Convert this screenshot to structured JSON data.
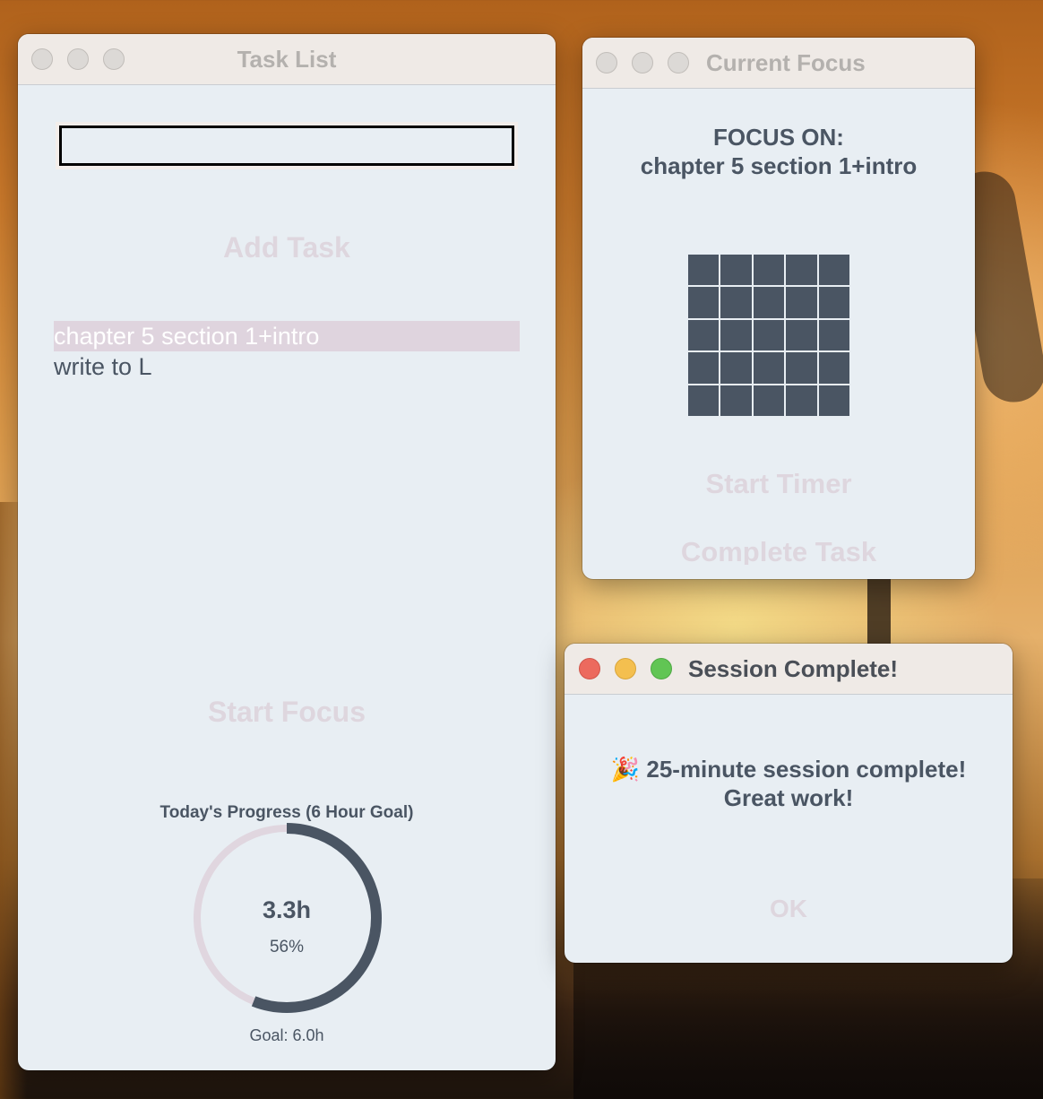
{
  "task_window": {
    "title": "Task List",
    "task_input": {
      "value": "",
      "placeholder": ""
    },
    "add_button": "Add Task",
    "tasks": [
      {
        "label": "chapter 5 section 1+intro",
        "selected": true
      },
      {
        "label": "write to L",
        "selected": false
      }
    ],
    "start_focus_button": "Start Focus",
    "progress": {
      "heading": "Today's Progress (6 Hour Goal)",
      "hours": "3.3h",
      "percent_label": "56%",
      "fraction": 0.56,
      "goal": "Goal: 6.0h"
    }
  },
  "focus_window": {
    "title": "Current Focus",
    "focus_label": "FOCUS ON:",
    "focus_task": "chapter 5 section 1+intro",
    "grid": {
      "rows": 5,
      "cols": 5
    },
    "start_timer_button": "Start Timer",
    "complete_task_button": "Complete Task"
  },
  "dialog": {
    "title": "Session Complete!",
    "emoji": "🎉",
    "message": "25-minute session complete!",
    "message2": "Great work!",
    "ok_button": "OK"
  },
  "colors": {
    "window_bg": "#e8eef3",
    "text": "#4a5563",
    "ring_progress": "#4a5563",
    "ring_track": "#e0d6df",
    "ghost_button": "#ded6de",
    "selection": "#dfd4de"
  }
}
